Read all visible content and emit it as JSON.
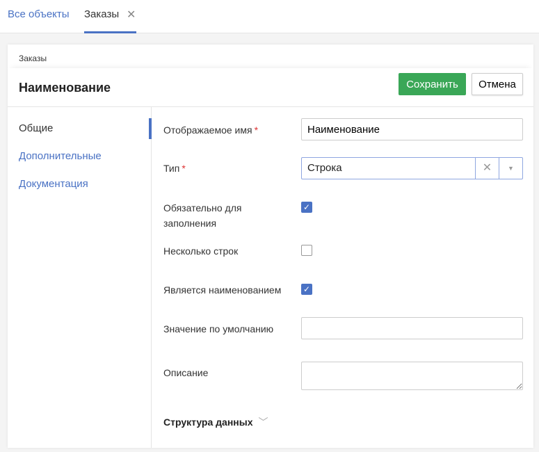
{
  "tabs": [
    {
      "label": "Все объекты"
    },
    {
      "label": "Заказы"
    }
  ],
  "breadcrumb": "Заказы",
  "header": {
    "title": "Наименование",
    "save": "Сохранить",
    "cancel": "Отмена"
  },
  "nav": [
    {
      "label": "Общие"
    },
    {
      "label": "Дополнительные"
    },
    {
      "label": "Документация"
    }
  ],
  "form": {
    "display_name": {
      "label": "Отображаемое имя",
      "value": "Наименование"
    },
    "type": {
      "label": "Тип",
      "value": "Строка"
    },
    "required": {
      "label": "Обязательно для заполнения",
      "checked": true
    },
    "multiline": {
      "label": "Несколько строк",
      "checked": false
    },
    "is_name": {
      "label": "Является наименованием",
      "checked": true
    },
    "default": {
      "label": "Значение по умолчанию",
      "value": ""
    },
    "description": {
      "label": "Описание",
      "value": ""
    },
    "section": "Структура данных"
  },
  "required_mark": "*"
}
